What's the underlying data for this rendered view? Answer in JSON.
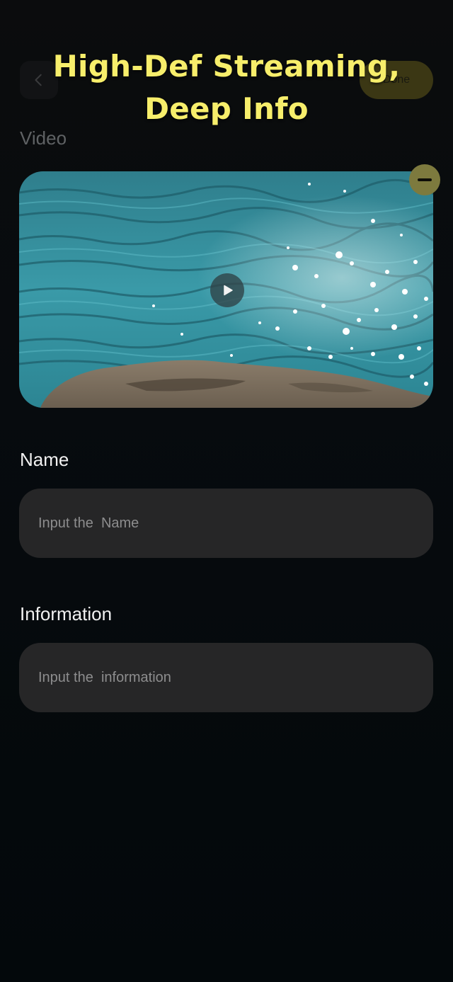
{
  "header": {
    "back_icon": "chevron-left-icon",
    "done_label": "Done"
  },
  "banner": {
    "line1": "High-Def Streaming,",
    "line2": "Deep Info",
    "color": "#f7ee6b"
  },
  "video": {
    "section_label": "Video",
    "play_icon": "play-icon",
    "remove_icon": "minus-circle-icon"
  },
  "form": {
    "name_label": "Name",
    "name_placeholder": "Input the  Name",
    "info_label": "Information",
    "info_placeholder": "Input the  information"
  },
  "colors": {
    "accent": "#7d7a3e",
    "field_bg": "#262627",
    "background": "#060b0e"
  }
}
